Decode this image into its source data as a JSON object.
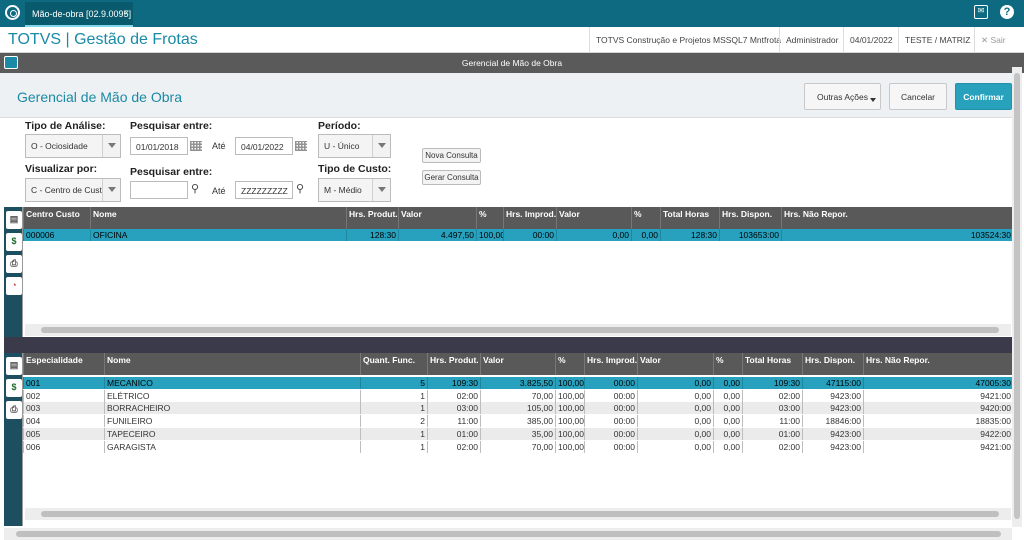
{
  "tab": {
    "label": "Mão-de-obra [02.9.0095]",
    "close": "×"
  },
  "app": {
    "title": "TOTVS | Gestão de Frotas",
    "company": "TOTVS Construção e Projetos MSSQL7 Mntfrota",
    "user": "Administrador",
    "date": "04/01/2022",
    "branch": "TESTE / MATRIZ",
    "exit": "Sair"
  },
  "window": {
    "title": "Gerencial de Mão de Obra"
  },
  "page": {
    "title": "Gerencial de Mão de Obra",
    "btn_more": "Outras Ações",
    "btn_cancel": "Cancelar",
    "btn_confirm": "Confirmar"
  },
  "filters": {
    "tipo_analise_label": "Tipo de Análise:",
    "tipo_analise_value": "O - Ociosidade",
    "pesquisar1_label": "Pesquisar entre:",
    "date_from": "01/01/2018",
    "ate1": "Até",
    "date_to": "04/01/2022",
    "periodo_label": "Período:",
    "periodo_value": "U - Único",
    "nova_consulta": "Nova Consulta",
    "gerar_consulta": "Gerar Consulta",
    "visualizar_label": "Visualizar por:",
    "visualizar_value": "C - Centro de Custo",
    "pesquisar2_label": "Pesquisar entre:",
    "search_from": "",
    "ate2": "Até",
    "search_to": "ZZZZZZZZZ",
    "tipo_custo_label": "Tipo de Custo:",
    "tipo_custo_value": "M - Médio"
  },
  "grid1": {
    "headers": [
      "Centro Custo",
      "Nome",
      "Hrs. Produt.",
      "Valor",
      "%",
      "Hrs. Improd.",
      "Valor",
      "%",
      "Total Horas",
      "Hrs. Dispon.",
      "Hrs. Não Repor."
    ],
    "rows": [
      [
        "000006",
        "OFICINA",
        "128:30",
        "4.497,50",
        "100,00",
        "00:00",
        "0,00",
        "0,00",
        "128:30",
        "103653:00",
        "103524:30"
      ]
    ]
  },
  "grid2": {
    "headers": [
      "Especialidade",
      "Nome",
      "Quant. Func.",
      "Hrs. Produt.",
      "Valor",
      "%",
      "Hrs. Improd.",
      "Valor",
      "%",
      "Total Horas",
      "Hrs. Dispon.",
      "Hrs. Não Repor."
    ],
    "rows": [
      [
        "001",
        "MECANICO",
        "5",
        "109:30",
        "3.825,50",
        "100,00",
        "00:00",
        "0,00",
        "0,00",
        "109:30",
        "47115:00",
        "47005:30"
      ],
      [
        "002",
        "ELÉTRICO",
        "1",
        "02:00",
        "70,00",
        "100,00",
        "00:00",
        "0,00",
        "0,00",
        "02:00",
        "9423:00",
        "9421:00"
      ],
      [
        "003",
        "BORRACHEIRO",
        "1",
        "03:00",
        "105,00",
        "100,00",
        "00:00",
        "0,00",
        "0,00",
        "03:00",
        "9423:00",
        "9420:00"
      ],
      [
        "004",
        "FUNILEIRO",
        "2",
        "11:00",
        "385,00",
        "100,00",
        "00:00",
        "0,00",
        "0,00",
        "11:00",
        "18846:00",
        "18835:00"
      ],
      [
        "005",
        "TAPECEIRO",
        "1",
        "01:00",
        "35,00",
        "100,00",
        "00:00",
        "0,00",
        "0,00",
        "01:00",
        "9423:00",
        "9422:00"
      ],
      [
        "006",
        "GARAGISTA",
        "1",
        "02:00",
        "70,00",
        "100,00",
        "00:00",
        "0,00",
        "0,00",
        "02:00",
        "9423:00",
        "9421:00"
      ]
    ]
  }
}
